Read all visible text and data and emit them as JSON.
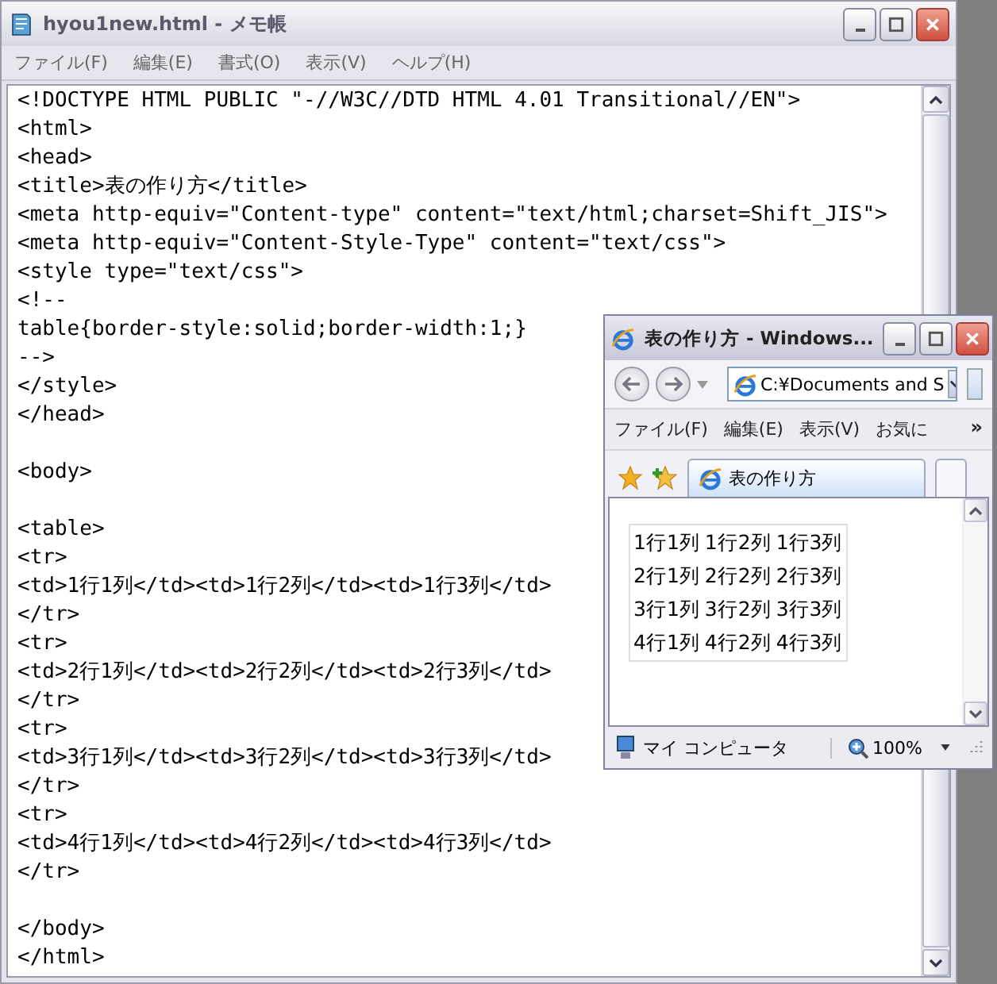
{
  "notepad": {
    "title": "hyou1new.html - メモ帳",
    "menu": [
      "ファイル(F)",
      "編集(E)",
      "書式(O)",
      "表示(V)",
      "ヘルプ(H)"
    ],
    "blocks": [
      [
        "<!DOCTYPE HTML PUBLIC \"-//W3C//DTD HTML 4.01 Transitional//EN\">",
        "<html>",
        "<head>",
        "<title>表の作り方</title>",
        "<meta http-equiv=\"Content-type\" content=\"text/html;charset=Shift_JIS\">",
        "<meta http-equiv=\"Content-Style-Type\" content=\"text/css\">",
        "<style type=\"text/css\">",
        "<!--",
        "table{border-style:solid;border-width:1;}",
        "-->",
        "</style>",
        "</head>"
      ],
      [
        "<body>"
      ],
      [
        "<table>",
        "<tr>",
        "<td>1行1列</td><td>1行2列</td><td>1行3列</td>",
        "</tr>",
        "<tr>",
        "<td>2行1列</td><td>2行2列</td><td>2行3列</td>",
        "</tr>",
        "<tr>",
        "<td>3行1列</td><td>3行2列</td><td>3行3列</td>",
        "</tr>",
        "<tr>",
        "<td>4行1列</td><td>4行2列</td><td>4行3列</td>",
        "</tr>"
      ],
      [
        "</body>",
        "</html>"
      ]
    ]
  },
  "browser": {
    "title": "表の作り方 - Windows...",
    "address": "C:¥Documents and S",
    "menu": [
      "ファイル(F)",
      "編集(E)",
      "表示(V)",
      "お気に"
    ],
    "more": "»",
    "tab": {
      "label": "表の作り方",
      "selected": true
    },
    "table": [
      [
        "1行1列",
        "1行2列",
        "1行3列"
      ],
      [
        "2行1列",
        "2行2列",
        "2行3列"
      ],
      [
        "3行1列",
        "3行2列",
        "3行3列"
      ],
      [
        "4行1列",
        "4行2列",
        "4行3列"
      ]
    ],
    "status": "マイ コンピュータ",
    "zoom": "100%"
  }
}
